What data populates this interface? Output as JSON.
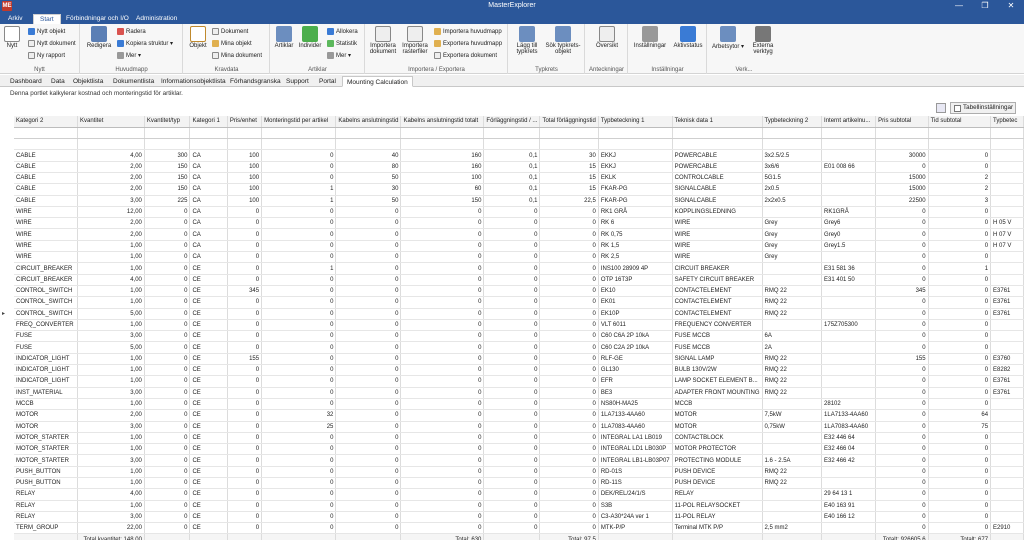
{
  "window": {
    "title": "MasterExplorer",
    "app_icon": "ME",
    "minimize": "—",
    "restore": "❐",
    "close": "✕"
  },
  "menu": {
    "tabs": [
      "Arkiv",
      "Start",
      "Förbindningar och I/O",
      "Administration"
    ],
    "active": "Start"
  },
  "ribbon": {
    "groups": [
      {
        "label": "Nytt",
        "big": [
          {
            "label": "Nytt",
            "icon": "new-doc-icon"
          }
        ],
        "small": [
          {
            "label": "Nytt objekt",
            "icon": "new-object-icon"
          },
          {
            "label": "Nytt dokument",
            "icon": "new-document-icon"
          },
          {
            "label": "Ny rapport",
            "icon": "new-report-icon"
          }
        ]
      },
      {
        "label": "Huvudmapp",
        "big": [
          {
            "label": "Redigera",
            "icon": "edit-icon"
          }
        ],
        "small": [
          {
            "label": "Radera",
            "icon": "delete-icon"
          },
          {
            "label": "Kopiera struktur ▾",
            "icon": "copy-structure-icon"
          },
          {
            "label": "Mer ▾",
            "icon": "more-icon"
          }
        ]
      },
      {
        "label": "Kravdata",
        "big": [
          {
            "label": "Objekt",
            "icon": "object-icon"
          }
        ],
        "small": [
          {
            "label": "Dokument",
            "icon": "document-icon"
          },
          {
            "label": "Mina objekt",
            "icon": "my-objects-icon"
          },
          {
            "label": "Mina dokument",
            "icon": "my-documents-icon"
          }
        ]
      },
      {
        "label": "Artiklar",
        "big": [
          {
            "label": "Artiklar",
            "icon": "articles-icon"
          },
          {
            "label": "Individer",
            "icon": "individuals-icon"
          }
        ],
        "small": [
          {
            "label": "Allokera",
            "icon": "allocate-icon"
          },
          {
            "label": "Statistik",
            "icon": "statistics-icon"
          },
          {
            "label": "Mer ▾",
            "icon": "more-icon"
          }
        ]
      },
      {
        "label": "Importera / Exportera",
        "big": [
          {
            "label": "Importera dokument",
            "icon": "import-document-icon"
          },
          {
            "label": "Importera rasterfiler",
            "icon": "import-raster-icon"
          }
        ],
        "small": [
          {
            "label": "Importera huvudmapp",
            "icon": "import-folder-icon"
          },
          {
            "label": "Exportera huvudmapp",
            "icon": "export-folder-icon"
          },
          {
            "label": "Exportera dokument",
            "icon": "export-document-icon"
          }
        ]
      },
      {
        "label": "Typkrets",
        "big": [
          {
            "label": "Lägg till typkrets",
            "icon": "add-typecircuit-icon"
          },
          {
            "label": "Sök typkrets-objekt",
            "icon": "search-typecircuit-icon"
          }
        ],
        "small": []
      },
      {
        "label": "Anteckningar",
        "big": [
          {
            "label": "Översikt",
            "icon": "overview-icon"
          }
        ],
        "small": []
      },
      {
        "label": "Inställningar",
        "big": [
          {
            "label": "Inställningar",
            "icon": "settings-icon"
          },
          {
            "label": "Aktivstatus",
            "icon": "active-status-icon"
          }
        ],
        "small": []
      },
      {
        "label": "Verk...",
        "big": [
          {
            "label": "Arbetsytor ▾",
            "icon": "workspaces-icon"
          },
          {
            "label": "Externa verktyg",
            "icon": "external-tools-icon"
          }
        ],
        "small": []
      }
    ]
  },
  "doc_tabs": {
    "items": [
      "Dashboard",
      "Data",
      "Objektlista",
      "Dokumentlista",
      "Informationsobjektlista",
      "Förhandsgranska",
      "Support",
      "Portal",
      "Mounting Calculation"
    ],
    "active": "Mounting Calculation"
  },
  "description": "Denna portlet kalkylerar kostnad och monteringstid för artiklar.",
  "grid_toolbar": {
    "settings_label": "Tabellinställningar"
  },
  "grid": {
    "columns": [
      "Kategori 2",
      "Kvantitet",
      "Kvantitet/typ",
      "Kategori 1",
      "Pris/enhet",
      "Monteringstid per artikel",
      "Kabelns anslutningstid",
      "Kabelns anslutningstid totalt",
      "Förläggningstid / ...",
      "Total förläggningstid",
      "Typbeteckning 1",
      "Teknisk data 1",
      "Typbeteckning 2",
      "Internt artikelnu...",
      "Pris subtotal",
      "Tid subtotal",
      "Typbetec"
    ],
    "numeric": [
      false,
      true,
      true,
      false,
      true,
      true,
      true,
      true,
      true,
      true,
      false,
      false,
      false,
      false,
      true,
      true,
      false
    ],
    "rows": [
      [
        "CABLE",
        "4,00",
        "300",
        "CA",
        "100",
        "0",
        "40",
        "160",
        "0,1",
        "30",
        "EKKJ",
        "POWERCABLE",
        "3x2.5/2.5",
        "",
        "30000",
        "0",
        ""
      ],
      [
        "CABLE",
        "2,00",
        "150",
        "CA",
        "100",
        "0",
        "80",
        "160",
        "0,1",
        "15",
        "EKKJ",
        "POWERCABLE",
        "3x6/6",
        "E01 008 66",
        "0",
        "0",
        ""
      ],
      [
        "CABLE",
        "2,00",
        "150",
        "CA",
        "100",
        "0",
        "50",
        "100",
        "0,1",
        "15",
        "EKLK",
        "CONTROLCABLE",
        "5G1.5",
        "",
        "15000",
        "2",
        ""
      ],
      [
        "CABLE",
        "2,00",
        "150",
        "CA",
        "100",
        "1",
        "30",
        "60",
        "0,1",
        "15",
        "FKAR-PG",
        "SIGNALCABLE",
        "2x0.5",
        "",
        "15000",
        "2",
        ""
      ],
      [
        "CABLE",
        "3,00",
        "225",
        "CA",
        "100",
        "1",
        "50",
        "150",
        "0,1",
        "22,5",
        "FKAR-PG",
        "SIGNALCABLE",
        "2x2x0.5",
        "",
        "22500",
        "3",
        ""
      ],
      [
        "WIRE",
        "12,00",
        "0",
        "CA",
        "0",
        "0",
        "0",
        "0",
        "0",
        "0",
        "RK1 GRÅ",
        "KOPPLINGSLEDNING",
        "",
        "RK1GRÅ",
        "0",
        "0",
        ""
      ],
      [
        "WIRE",
        "2,00",
        "0",
        "CA",
        "0",
        "0",
        "0",
        "0",
        "0",
        "0",
        "RK 6",
        "WIRE",
        "Grey",
        "Grey6",
        "0",
        "0",
        "H 05 V"
      ],
      [
        "WIRE",
        "2,00",
        "0",
        "CA",
        "0",
        "0",
        "0",
        "0",
        "0",
        "0",
        "RK 0,75",
        "WIRE",
        "Grey",
        "Grey0",
        "0",
        "0",
        "H 07 V"
      ],
      [
        "WIRE",
        "1,00",
        "0",
        "CA",
        "0",
        "0",
        "0",
        "0",
        "0",
        "0",
        "RK 1,5",
        "WIRE",
        "Grey",
        "Grey1.5",
        "0",
        "0",
        "H 07 V"
      ],
      [
        "WIRE",
        "1,00",
        "0",
        "CA",
        "0",
        "0",
        "0",
        "0",
        "0",
        "0",
        "RK 2,5",
        "WIRE",
        "Grey",
        "",
        "0",
        "0",
        ""
      ],
      [
        "CIRCUIT_BREAKER",
        "1,00",
        "0",
        "CE",
        "0",
        "1",
        "0",
        "0",
        "0",
        "0",
        "INS100 28909 4P",
        "CIRCUIT BREAKER",
        "",
        "E31 581 36",
        "0",
        "1",
        ""
      ],
      [
        "CIRCUIT_BREAKER",
        "4,00",
        "0",
        "CE",
        "0",
        "0",
        "0",
        "0",
        "0",
        "0",
        "OTP 16T3P",
        "SAFETY CIRCUIT BREAKER",
        "",
        "E31 401 50",
        "0",
        "0",
        ""
      ],
      [
        "CONTROL_SWITCH",
        "1,00",
        "0",
        "CE",
        "345",
        "0",
        "0",
        "0",
        "0",
        "0",
        "EK10",
        "CONTACTELEMENT",
        "RMQ 22",
        "",
        "345",
        "0",
        "E3761"
      ],
      [
        "CONTROL_SWITCH",
        "1,00",
        "0",
        "CE",
        "0",
        "0",
        "0",
        "0",
        "0",
        "0",
        "EK01",
        "CONTACTELEMENT",
        "RMQ 22",
        "",
        "0",
        "0",
        "E3761"
      ],
      [
        "CONTROL_SWITCH",
        "5,00",
        "0",
        "CE",
        "0",
        "0",
        "0",
        "0",
        "0",
        "0",
        "EK10P",
        "CONTACTELEMENT",
        "RMQ 22",
        "",
        "0",
        "0",
        "E3761"
      ],
      [
        "FREQ_CONVERTER",
        "1,00",
        "0",
        "CE",
        "0",
        "0",
        "0",
        "0",
        "0",
        "0",
        "VLT 6011",
        "FREQUENCY CONVERTER",
        "",
        "175Z705300",
        "0",
        "0",
        ""
      ],
      [
        "FUSE",
        "3,00",
        "0",
        "CE",
        "0",
        "0",
        "0",
        "0",
        "0",
        "0",
        "C60 C6A 2P 10kA",
        "FUSE MCCB",
        "6A",
        "",
        "0",
        "0",
        ""
      ],
      [
        "FUSE",
        "5,00",
        "0",
        "CE",
        "0",
        "0",
        "0",
        "0",
        "0",
        "0",
        "C60 C2A 2P 10kA",
        "FUSE MCCB",
        "2A",
        "",
        "0",
        "0",
        ""
      ],
      [
        "INDICATOR_LIGHT",
        "1,00",
        "0",
        "CE",
        "155",
        "0",
        "0",
        "0",
        "0",
        "0",
        "RLF-GE",
        "SIGNAL LAMP",
        "RMQ 22",
        "",
        "155",
        "0",
        "E3760"
      ],
      [
        "INDICATOR_LIGHT",
        "1,00",
        "0",
        "CE",
        "0",
        "0",
        "0",
        "0",
        "0",
        "0",
        "GL130",
        "BULB 130V/2W",
        "RMQ 22",
        "",
        "0",
        "0",
        "E8282"
      ],
      [
        "INDICATOR_LIGHT",
        "1,00",
        "0",
        "CE",
        "0",
        "0",
        "0",
        "0",
        "0",
        "0",
        "EFR",
        "LAMP SOCKET ELEMENT B...",
        "RMQ 22",
        "",
        "0",
        "0",
        "E3761"
      ],
      [
        "INST_MATERIAL",
        "3,00",
        "0",
        "CE",
        "0",
        "0",
        "0",
        "0",
        "0",
        "0",
        "BE3",
        "ADAPTER FRONT MOUNTING",
        "RMQ 22",
        "",
        "0",
        "0",
        "E3761"
      ],
      [
        "MCCB",
        "1,00",
        "0",
        "CE",
        "0",
        "0",
        "0",
        "0",
        "0",
        "0",
        "NS80H-MA25",
        "MCCB",
        "",
        "28102",
        "0",
        "0",
        ""
      ],
      [
        "MOTOR",
        "2,00",
        "0",
        "CE",
        "0",
        "32",
        "0",
        "0",
        "0",
        "0",
        "1LA7133-4AA60",
        "MOTOR",
        "7,5kW",
        "1LA7133-4AA60",
        "0",
        "64",
        ""
      ],
      [
        "MOTOR",
        "3,00",
        "0",
        "CE",
        "0",
        "25",
        "0",
        "0",
        "0",
        "0",
        "1LA7083-4AA60",
        "MOTOR",
        "0,75kW",
        "1LA7083-4AA60",
        "0",
        "75",
        ""
      ],
      [
        "MOTOR_STARTER",
        "1,00",
        "0",
        "CE",
        "0",
        "0",
        "0",
        "0",
        "0",
        "0",
        "INTEGRAL LA1 LB019",
        "CONTACTBLOCK",
        "",
        "E32 446 64",
        "0",
        "0",
        ""
      ],
      [
        "MOTOR_STARTER",
        "1,00",
        "0",
        "CE",
        "0",
        "0",
        "0",
        "0",
        "0",
        "0",
        "INTEGRAL LD1 LB030P",
        "MOTOR PROTECTOR",
        "",
        "E32 466 04",
        "0",
        "0",
        ""
      ],
      [
        "MOTOR_STARTER",
        "3,00",
        "0",
        "CE",
        "0",
        "0",
        "0",
        "0",
        "0",
        "0",
        "INTEGRAL LB1-LB03P07",
        "PROTECTING MODULE",
        "1.6 - 2.5A",
        "E32 466 42",
        "0",
        "0",
        ""
      ],
      [
        "PUSH_BUTTON",
        "1,00",
        "0",
        "CE",
        "0",
        "0",
        "0",
        "0",
        "0",
        "0",
        "RD-01S",
        "PUSH DEVICE",
        "RMQ 22",
        "",
        "0",
        "0",
        ""
      ],
      [
        "PUSH_BUTTON",
        "1,00",
        "0",
        "CE",
        "0",
        "0",
        "0",
        "0",
        "0",
        "0",
        "RD-11S",
        "PUSH DEVICE",
        "RMQ 22",
        "",
        "0",
        "0",
        ""
      ],
      [
        "RELAY",
        "4,00",
        "0",
        "CE",
        "0",
        "0",
        "0",
        "0",
        "0",
        "0",
        "DEK/REL/24/1/S",
        "RELAY",
        "",
        "29 64 13 1",
        "0",
        "0",
        ""
      ],
      [
        "RELAY",
        "1,00",
        "0",
        "CE",
        "0",
        "0",
        "0",
        "0",
        "0",
        "0",
        "S3B",
        "11-POL RELAYSOCKET",
        "",
        "E40 163 91",
        "0",
        "0",
        ""
      ],
      [
        "RELAY",
        "3,00",
        "0",
        "CE",
        "0",
        "0",
        "0",
        "0",
        "0",
        "0",
        "C3-A30*24A ver 1",
        "11-POL RELAY",
        "",
        "E40 166 12",
        "0",
        "0",
        ""
      ],
      [
        "TERM_GROUP",
        "22,00",
        "0",
        "CE",
        "0",
        "0",
        "0",
        "0",
        "0",
        "0",
        "MTK-P/P",
        "Terminal MTK P/P",
        "2,5 mm2",
        "",
        "0",
        "0",
        "E2910"
      ]
    ],
    "totals": [
      "",
      "Total kvantitet: 148,00",
      "",
      "",
      "",
      "",
      "",
      "Total: 630",
      "",
      "Total: 97,5",
      "",
      "",
      "",
      "",
      "Totalt: 926605,6",
      "Totalt: 677",
      ""
    ]
  }
}
